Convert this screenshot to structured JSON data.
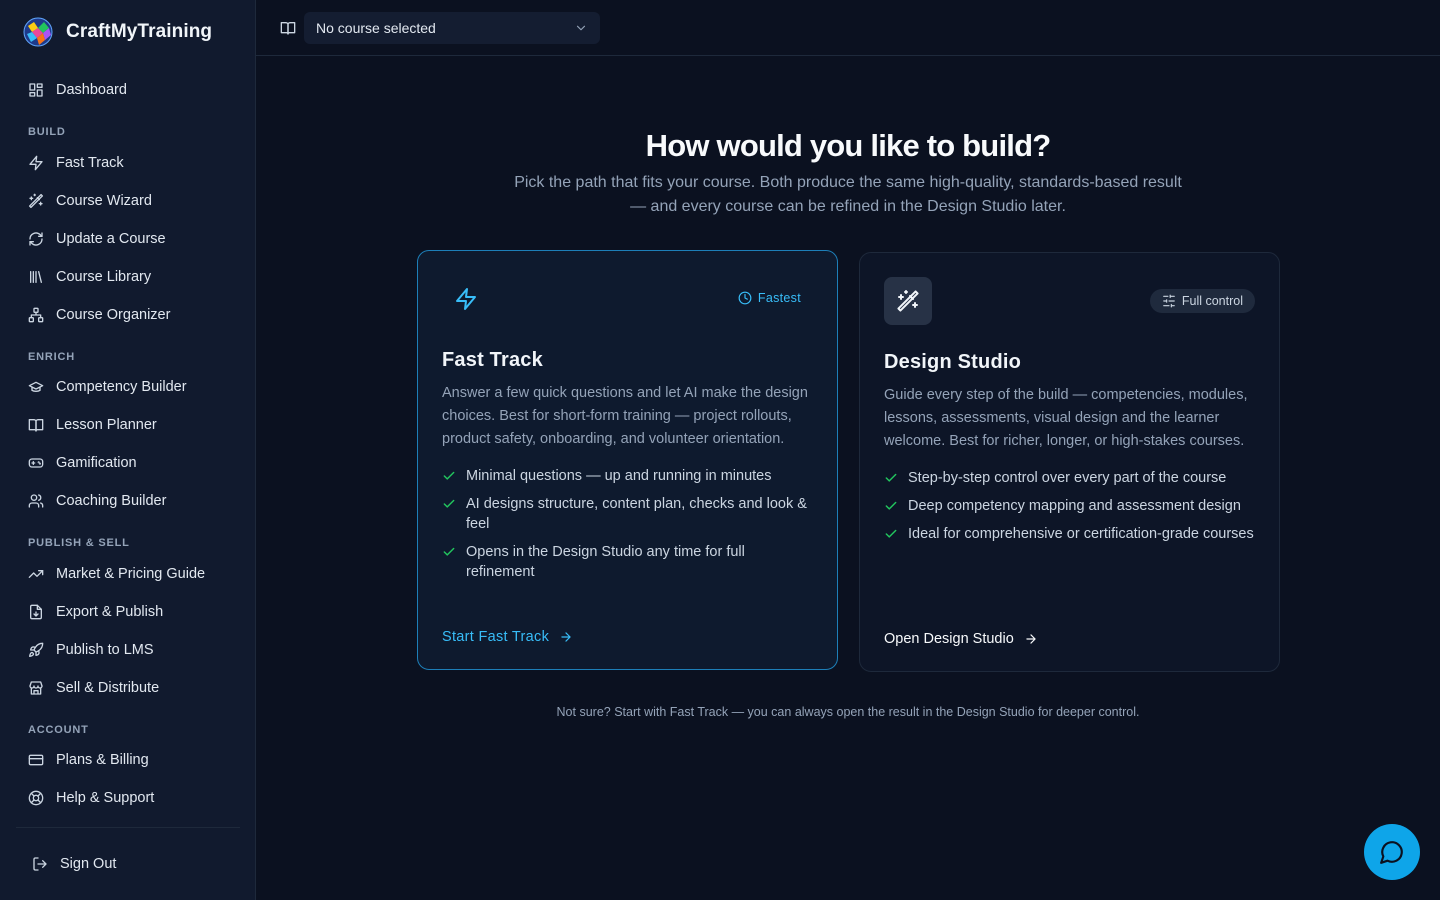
{
  "app": {
    "name": "CraftMyTraining"
  },
  "sidebar": {
    "dashboard": {
      "label": "Dashboard"
    },
    "sections": {
      "build": "BUILD",
      "enrich": "ENRICH",
      "publish": "PUBLISH & SELL",
      "account": "ACCOUNT"
    },
    "items": {
      "fast_track": "Fast Track",
      "course_wizard": "Course Wizard",
      "update_course": "Update a Course",
      "course_library": "Course Library",
      "course_organizer": "Course Organizer",
      "competency_builder": "Competency Builder",
      "lesson_planner": "Lesson Planner",
      "gamification": "Gamification",
      "coaching_builder": "Coaching Builder",
      "market_pricing": "Market & Pricing Guide",
      "export_publish": "Export & Publish",
      "publish_lms": "Publish to LMS",
      "sell_distribute": "Sell & Distribute",
      "plans_billing": "Plans & Billing",
      "help_support": "Help & Support"
    },
    "sign_out": "Sign Out"
  },
  "topbar": {
    "course_select": "No course selected"
  },
  "main": {
    "heading": "How would you like to build?",
    "subheading": "Pick the path that fits your course. Both produce the same high-quality, standards-based result — and every course can be refined in the Design Studio later.",
    "footnote": "Not sure? Start with Fast Track — you can always open the result in the Design Studio for deeper control."
  },
  "cards": {
    "fast": {
      "badge": "Fastest",
      "title": "Fast Track",
      "description": "Answer a few quick questions and let AI make the design choices. Best for short-form training — project rollouts, product safety, onboarding, and volunteer orientation.",
      "features": [
        "Minimal questions — up and running in minutes",
        "AI designs structure, content plan, checks and look & feel",
        "Opens in the Design Studio any time for full refinement"
      ],
      "cta": "Start Fast Track"
    },
    "studio": {
      "badge": "Full control",
      "title": "Design Studio",
      "description": "Guide every step of the build — competencies, modules, lessons, assessments, visual design and the learner welcome. Best for richer, longer, or high-stakes courses.",
      "features": [
        "Step-by-step control over every part of the course",
        "Deep competency mapping and assessment design",
        "Ideal for comprehensive or certification-grade courses"
      ],
      "cta": "Open Design Studio"
    }
  },
  "colors": {
    "accent": "#38bdf8",
    "check": "#22c55e",
    "background": "#0b1120",
    "sidebar": "#111a2e",
    "chat": "#0ea5e9"
  },
  "icons": {
    "dashboard": "layout-grid-icon",
    "fast_track": "zap-icon",
    "course_wizard": "wand-icon",
    "update": "refresh-icon",
    "library": "library-icon",
    "organizer": "workflow-icon",
    "competency": "graduation-cap-icon",
    "lesson": "book-open-icon",
    "gamification": "gamepad-icon",
    "coaching": "users-icon",
    "market": "trending-up-icon",
    "export": "file-icon",
    "lms": "rocket-icon",
    "sell": "store-icon",
    "billing": "credit-card-icon",
    "help": "life-buoy-icon",
    "signout": "log-out-icon",
    "chat": "message-circle-icon"
  }
}
